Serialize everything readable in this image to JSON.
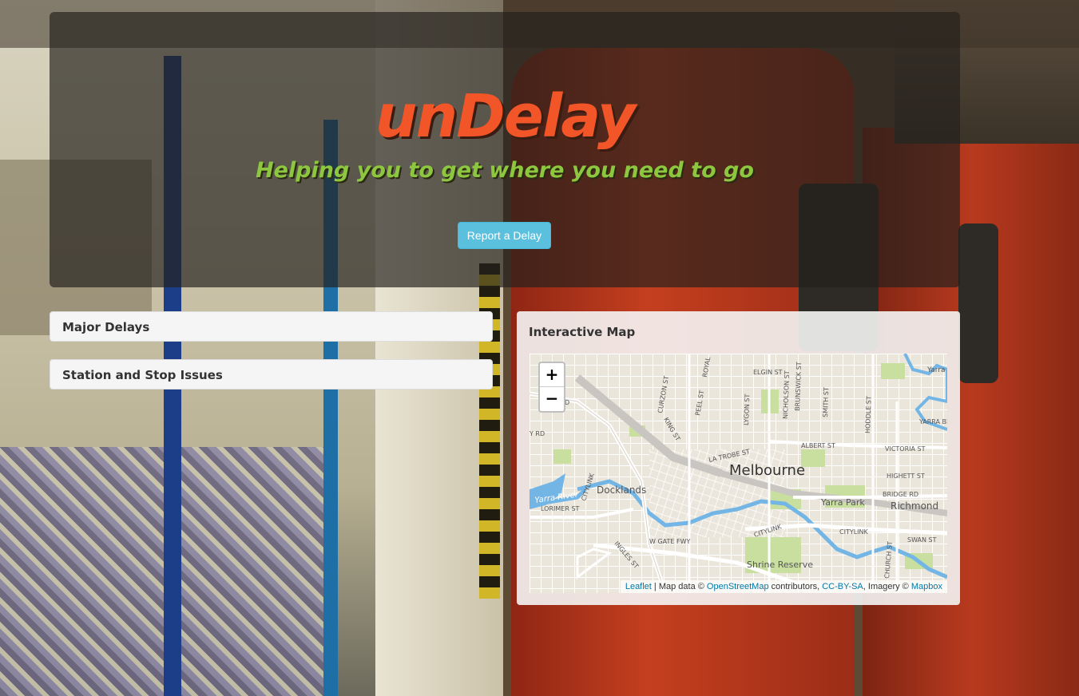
{
  "hero": {
    "brand": "unDelay",
    "tagline": "Helping you to get where you need to go",
    "report_button": "Report a Delay"
  },
  "panels": {
    "major_delays": "Major Delays",
    "station_issues": "Station and Stop Issues"
  },
  "map": {
    "title": "Interactive Map",
    "zoom_in": "+",
    "zoom_out": "−",
    "city_label": "Melbourne",
    "labels": {
      "docklands": "Docklands",
      "yarra_park": "Yarra Park",
      "richmond": "Richmond",
      "shrine_reserve": "Shrine Reserve",
      "yarra_river": "Yarra River",
      "elgin_st": "ELGIN ST",
      "albert_st": "ALBERT ST",
      "victoria_st": "VICTORIA ST",
      "bridge_rd": "BRIDGE RD",
      "highett_st": "HIGHETT ST",
      "swan_st": "SWAN ST",
      "citylink_1": "CITYLINK",
      "citylink_2": "CITYLINK",
      "citylink_3": "CITYLINK",
      "ingles_st": "INGLES ST",
      "w_gate_fwy": "W GATE FWY",
      "lorimer_st": "LORIMER ST",
      "yarra_blvd": "YARRA BLVD",
      "church_st": "CHURCH ST",
      "curzon_st": "CURZON ST",
      "king_st": "KING ST",
      "peel_st": "PEEL ST",
      "royal": "ROYAL",
      "lygon_st": "LYGON ST",
      "nicholson_st": "NICHOLSON ST",
      "brunswick_st": "BRUNSWICK ST",
      "smith_st": "SMITH ST",
      "hoddle_st": "HODDLE ST",
      "la_trobe_st": "LA TROBE ST",
      "yarra_top": "Yarra",
      "rd_left": "Y RD",
      "d_left": "D"
    },
    "attribution": {
      "leaflet": "Leaflet",
      "sep1": " | Map data © ",
      "osm": "OpenStreetMap",
      "sep2": " contributors, ",
      "license": "CC-BY-SA",
      "sep3": ", Imagery © ",
      "mapbox": "Mapbox"
    }
  },
  "colors": {
    "brand": "#f25527",
    "tagline": "#8dc63f",
    "button": "#5bc0de",
    "water": "#73b6e6",
    "park": "#c8df9f",
    "link": "#0078a8"
  }
}
